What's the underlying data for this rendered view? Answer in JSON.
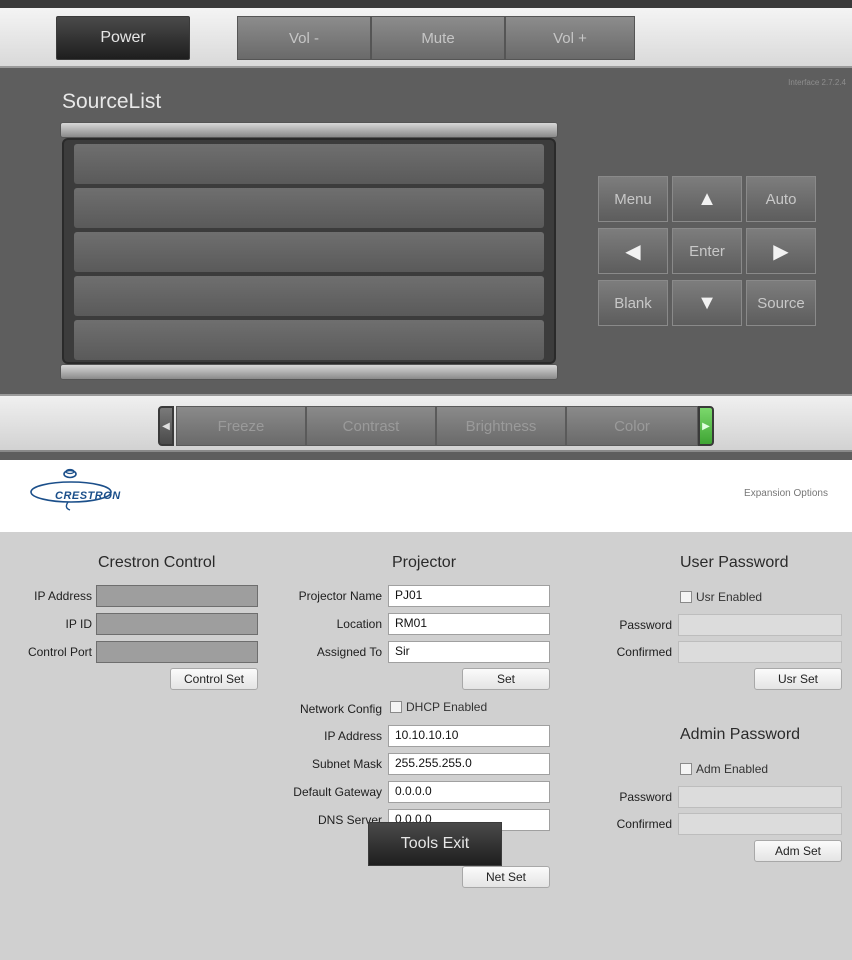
{
  "top_bar": {
    "power_label": "Power",
    "vol_minus_label": "Vol -",
    "mute_label": "Mute",
    "vol_plus_label": "Vol +"
  },
  "interface_version": "Interface 2.7.2.4",
  "source_list": {
    "title": "SourceList",
    "rows": [
      "",
      "",
      "",
      "",
      ""
    ]
  },
  "nav_pad": {
    "menu": "Menu",
    "up_icon": "triangle-up-icon",
    "auto": "Auto",
    "left_icon": "triangle-left-icon",
    "enter": "Enter",
    "right_icon": "triangle-right-icon",
    "blank": "Blank",
    "down_icon": "triangle-down-icon",
    "source": "Source"
  },
  "bottom_bar": {
    "items": [
      "Freeze",
      "Contrast",
      "Brightness",
      "Color"
    ],
    "left_arrow_icon": "left-arrow-icon",
    "right_arrow_icon": "right-arrow-icon"
  },
  "crestron": {
    "logo_text": "CRESTRON",
    "expansion_options": "Expansion Options"
  },
  "crestron_control": {
    "title": "Crestron Control",
    "ip_address_label": "IP Address",
    "ip_id_label": "IP ID",
    "control_port_label": "Control Port",
    "ip_address_value": "",
    "ip_id_value": "",
    "control_port_value": "",
    "control_set_label": "Control Set"
  },
  "projector": {
    "title": "Projector",
    "name_label": "Projector Name",
    "name_value": "PJ01",
    "location_label": "Location",
    "location_value": "RM01",
    "assigned_label": "Assigned To",
    "assigned_value": "Sir",
    "set_label": "Set",
    "network_config_label": "Network Config",
    "dhcp_label": "DHCP Enabled",
    "ip_label": "IP Address",
    "ip_value": "10.10.10.10",
    "subnet_label": "Subnet Mask",
    "subnet_value": "255.255.255.0",
    "gateway_label": "Default Gateway",
    "gateway_value": "0.0.0.0",
    "dns_label": "DNS Server",
    "dns_value": "0.0.0.0",
    "net_set_label": "Net Set"
  },
  "user_password": {
    "title": "User Password",
    "enabled_label": "Usr Enabled",
    "password_label": "Password",
    "confirmed_label": "Confirmed",
    "password_value": "",
    "confirmed_value": "",
    "set_label": "Usr Set"
  },
  "admin_password": {
    "title": "Admin Password",
    "enabled_label": "Adm Enabled",
    "password_label": "Password",
    "confirmed_label": "Confirmed",
    "password_value": "",
    "confirmed_value": "",
    "set_label": "Adm Set"
  },
  "tools_exit_label": "Tools Exit"
}
